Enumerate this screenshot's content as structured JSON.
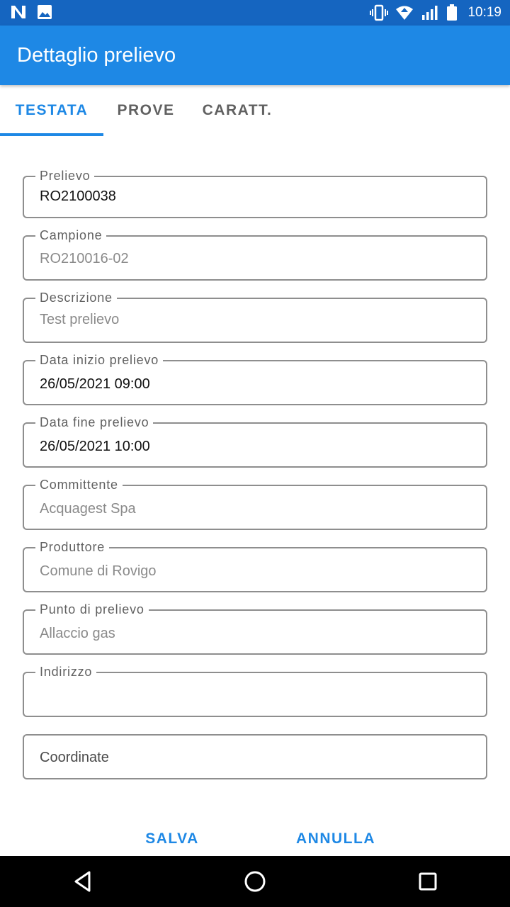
{
  "status_bar": {
    "time": "10:19",
    "left_icons": [
      "n-icon",
      "image-icon"
    ],
    "right_icons": [
      "vibrate-icon",
      "wifi-icon",
      "signal-icon",
      "battery-icon"
    ]
  },
  "app_bar": {
    "title": "Dettaglio prelievo"
  },
  "tabs": [
    {
      "label": "TESTATA",
      "active": true
    },
    {
      "label": "PROVE",
      "active": false
    },
    {
      "label": "CARATT.",
      "active": false
    }
  ],
  "form": {
    "prelievo": {
      "label": "Prelievo",
      "value": "RO2100038"
    },
    "campione": {
      "label": "Campione",
      "value": "RO210016-02"
    },
    "descrizione": {
      "label": "Descrizione",
      "value": "Test prelievo"
    },
    "data_inizio": {
      "label": "Data inizio prelievo",
      "value": "26/05/2021 09:00"
    },
    "data_fine": {
      "label": "Data fine prelievo",
      "value": "26/05/2021 10:00"
    },
    "committente": {
      "label": "Committente",
      "value": "Acquagest Spa"
    },
    "produttore": {
      "label": "Produttore",
      "value": "Comune di Rovigo"
    },
    "punto": {
      "label": "Punto di prelievo",
      "value": "Allaccio gas"
    },
    "indirizzo": {
      "label": "Indirizzo",
      "value": ""
    },
    "coordinate": {
      "placeholder": "Coordinate"
    }
  },
  "actions": {
    "save_label": "SALVA",
    "cancel_label": "ANNULLA"
  },
  "colors": {
    "status_bar": "#1565c0",
    "app_bar": "#1e88e5",
    "accent": "#1e88e5"
  }
}
